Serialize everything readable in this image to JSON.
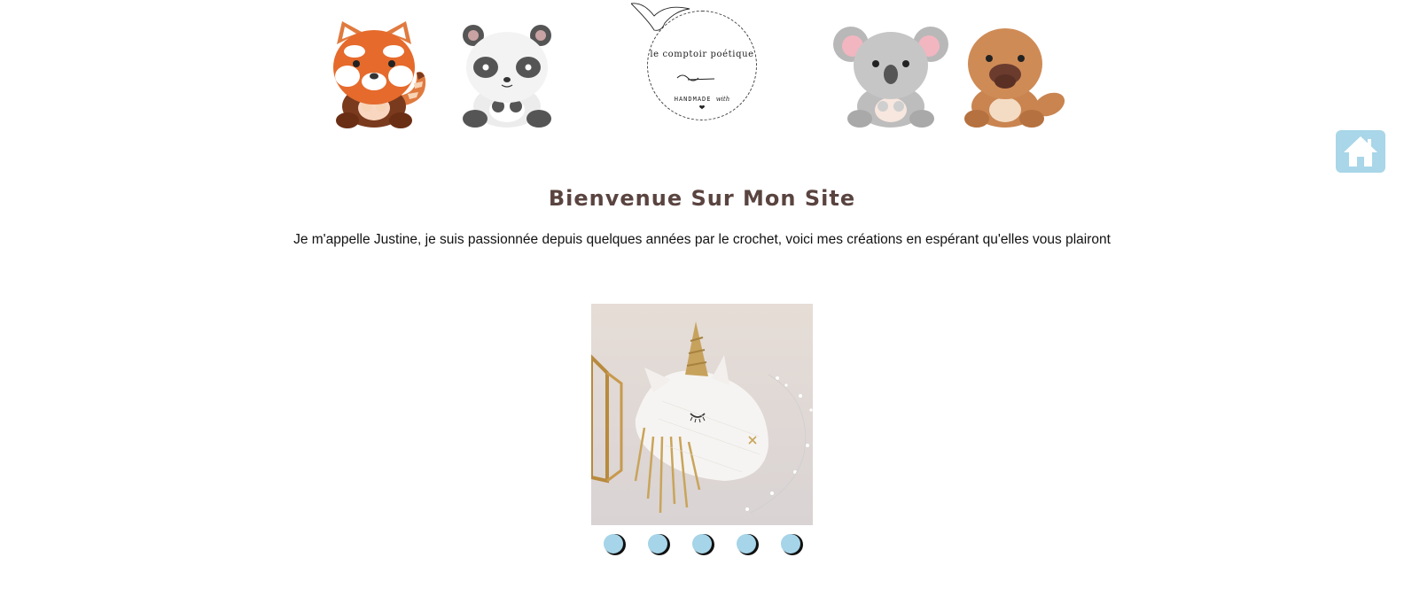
{
  "header": {
    "logo": {
      "title": "le comptoir poétique",
      "subtitle_main": "HANDMADE",
      "subtitle_script": "with",
      "heart": "❤"
    },
    "animals": [
      "red-panda",
      "panda",
      "koala",
      "platypus"
    ]
  },
  "nav": {
    "home_icon": "home-icon",
    "home_color": "#a9d6e8"
  },
  "welcome": {
    "title": "Bienvenue Sur Mon Site",
    "text": "Je m'appelle Justine, je suis passionnée depuis quelques années par le crochet, voici mes créations en espérant qu'elles vous plairont"
  },
  "carousel": {
    "slide_count": 5,
    "active_slide": 1,
    "dot_color": "#a6d4e8",
    "image_subject": "crochet unicorn head"
  },
  "colors": {
    "title": "#5a4440",
    "text": "#111111"
  }
}
